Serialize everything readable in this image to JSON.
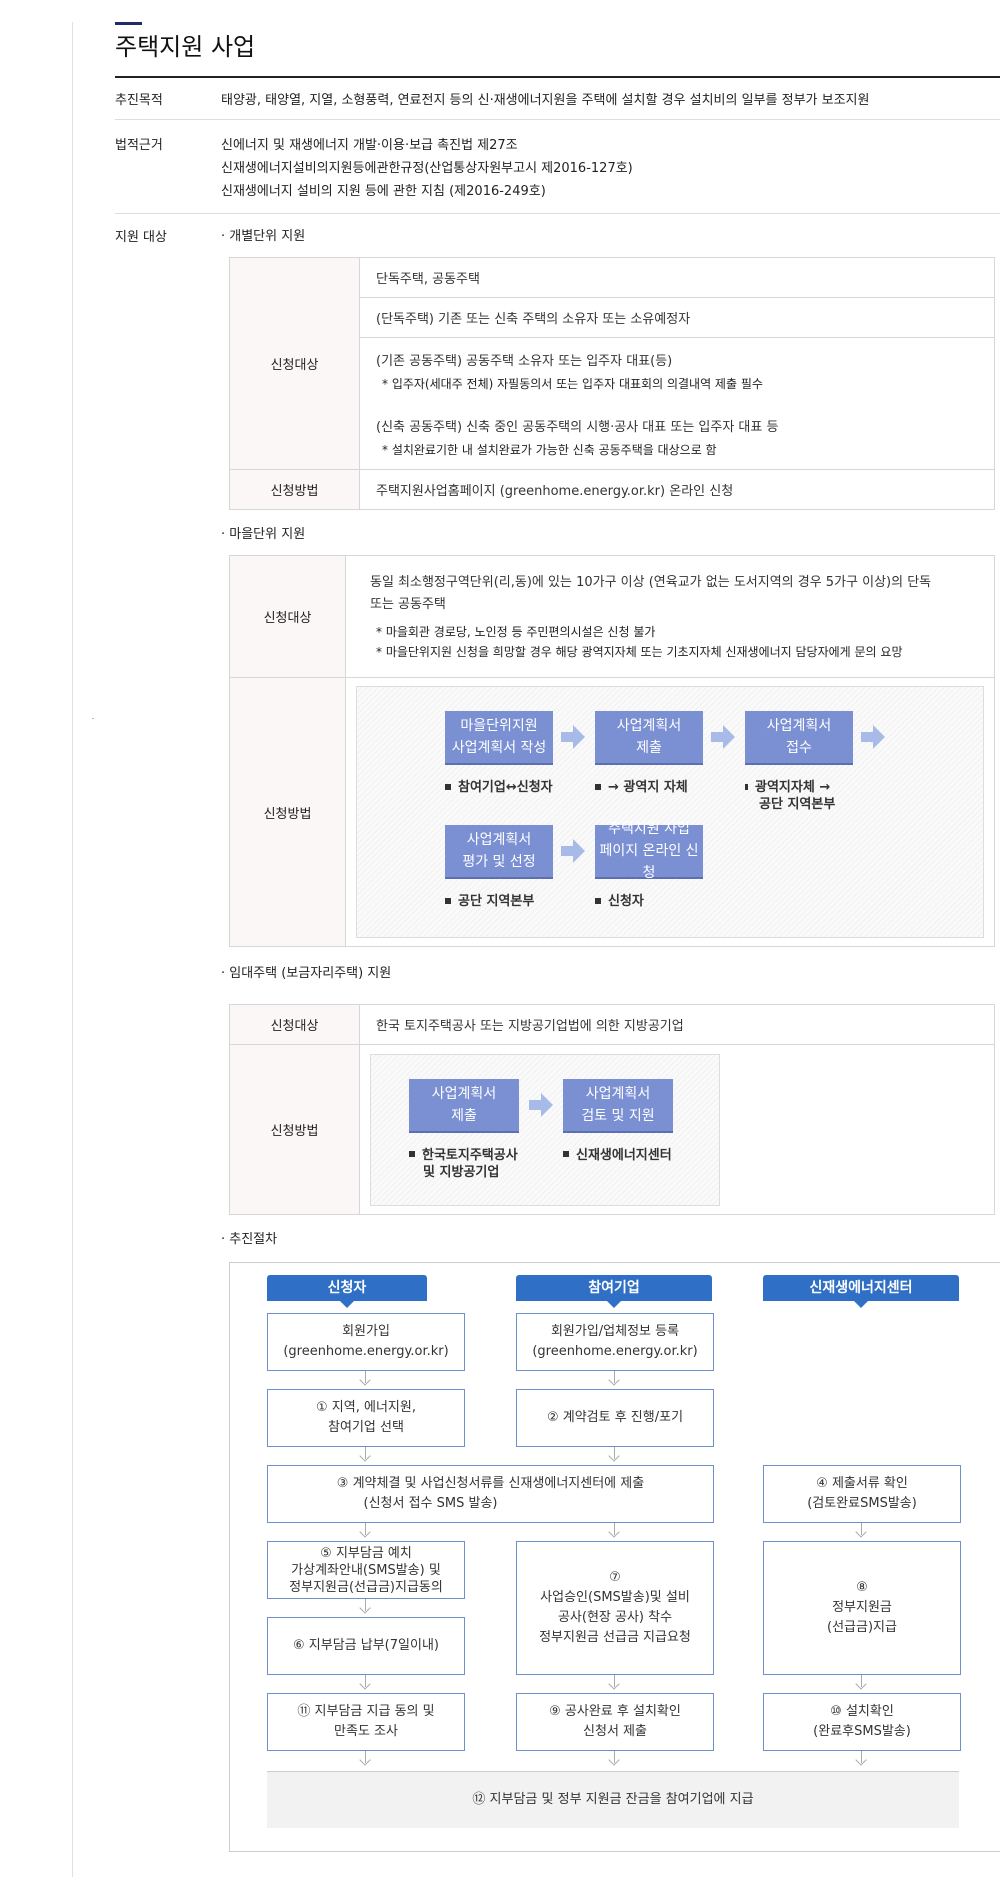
{
  "page_title": "주택지원 사업",
  "purpose": {
    "label": "추진목적",
    "value": "태양광, 태양열, 지열, 소형풍력, 연료전지 등의 신·재생에너지원을 주택에 설치할 경우 설치비의 일부를 정부가 보조지원"
  },
  "legal": {
    "label": "법적근거",
    "lines": [
      "신에너지 및 재생에너지 개발·이용·보급 촉진법 제27조",
      "신재생에너지설비의지원등에관한규정(산업통상자원부고시 제2016-127호)",
      "신재생에너지 설비의 지원 등에 관한 지침 (제2016-249호)"
    ]
  },
  "target": {
    "label": "지원 대상"
  },
  "individual": {
    "heading": "· 개별단위 지원",
    "apply_target_label": "신청대상",
    "rows": [
      "단독주택, 공동주택",
      "(단독주택) 기존 또는 신축 주택의 소유자 또는 소유예정자"
    ],
    "row3_line1": "(기존 공동주택) 공동주택 소유자 또는 입주자 대표(등)",
    "row3_note1": "* 입주자(세대주 전체) 자필동의서 또는 입주자 대표회의 의결내역 제출 필수",
    "row3_line2": "(신축 공동주택) 신축 중인 공동주택의 시행·공사 대표 또는 입주자 대표 등",
    "row3_note2": "* 설치완료기한 내 설치완료가 가능한 신축 공동주택을 대상으로 함",
    "apply_method_label": "신청방법",
    "apply_method": "주택지원사업홈페이지 (greenhome.energy.or.kr) 온라인 신청"
  },
  "village": {
    "heading": "· 마을단위 지원",
    "apply_target_label": "신청대상",
    "target_line1": "동일 최소행정구역단위(리,동)에 있는 10가구 이상 (연육교가 없는 도서지역의 경우 5가구 이상)의 단독",
    "target_line2": "또는 공동주택",
    "note1": "* 마을회관 경로당, 노인정 등 주민편의시설은 신청 불가",
    "note2": "* 마을단위지원 신청을 희망할 경우 해당 광역지자체 또는 기초지자체 신재생에너지 담당자에게 문의 요망",
    "apply_method_label": "신청방법",
    "flow": [
      {
        "l1": "마을단위지원",
        "l2": "사업계획서 작성",
        "cap1": "참여기업↔신청자",
        "cap2": ""
      },
      {
        "l1": "사업계획서",
        "l2": "제출",
        "cap1": "→ 광역지 자체",
        "cap2": ""
      },
      {
        "l1": "사업계획서",
        "l2": "접수",
        "cap1": "광역지자체 →",
        "cap2": "공단 지역본부"
      },
      {
        "l1": "사업계획서",
        "l2": "평가 및 선정",
        "cap1": "공단 지역본부",
        "cap2": ""
      },
      {
        "l1": "주택지원 사업",
        "l2": "페이지 온라인 신청",
        "cap1": "신청자",
        "cap2": ""
      }
    ]
  },
  "rental": {
    "heading": "· 임대주택 (보금자리주택) 지원",
    "apply_target_label": "신청대상",
    "apply_target": "한국 토지주택공사 또는 지방공기업법에 의한 지방공기업",
    "apply_method_label": "신청방법",
    "flow": [
      {
        "l1": "사업계획서",
        "l2": "제출",
        "cap1": "한국토지주택공사",
        "cap2": "및 지방공기업"
      },
      {
        "l1": "사업계획서",
        "l2": "검토 및 지원",
        "cap1": "신재생에너지센터",
        "cap2": ""
      }
    ]
  },
  "procedure": {
    "heading": "· 추진절차",
    "col_applicant": "신청자",
    "col_company": "참여기업",
    "col_center": "신재생에너지센터",
    "a1": [
      "회원가입",
      "(greenhome.energy.or.kr)"
    ],
    "b1": [
      "회원가입/업체정보 등록",
      "(greenhome.energy.or.kr)"
    ],
    "a2": [
      "① 지역, 에너지원,",
      "참여기업 선택"
    ],
    "b2": [
      "② 계약검토 후 진행/포기"
    ],
    "ab3": [
      "③ 계약체결 및 사업신청서류를 신재생에너지센터에 제출",
      "(신청서 접수 SMS 발송)"
    ],
    "c3": [
      "④ 제출서류 확인",
      "(검토완료SMS발송)"
    ],
    "a4": [
      "⑤ 지부담금 예치",
      "가상계좌안내(SMS발송) 및",
      "정부지원금(선급금)지급동의"
    ],
    "a5": [
      "⑥ 지부담금 납부(7일이내)"
    ],
    "b4": [
      "⑦",
      "사업승인(SMS발송)및 설비",
      "공사(현장 공사) 착수",
      "정부지원금 선급금 지급요청"
    ],
    "c4": [
      "⑧",
      "정부지원금",
      "(선급금)지급"
    ],
    "a6": [
      "⑪ 지부담금 지급 동의 및",
      "만족도 조사"
    ],
    "b6": [
      "⑨ 공사완료 후 설치확인",
      "신청서 제출"
    ],
    "c6": [
      "⑩ 설치확인",
      "(완료후SMS발송)"
    ],
    "final": "⑫ 지부담금 및 정부 지원금 잔금을 참여기업에 지급"
  },
  "colors": {
    "accent": "#1f2b6b",
    "flow_box": "#7b8fd3",
    "header_blue": "#2f6fc5",
    "th_bg": "#fbf7f6"
  }
}
